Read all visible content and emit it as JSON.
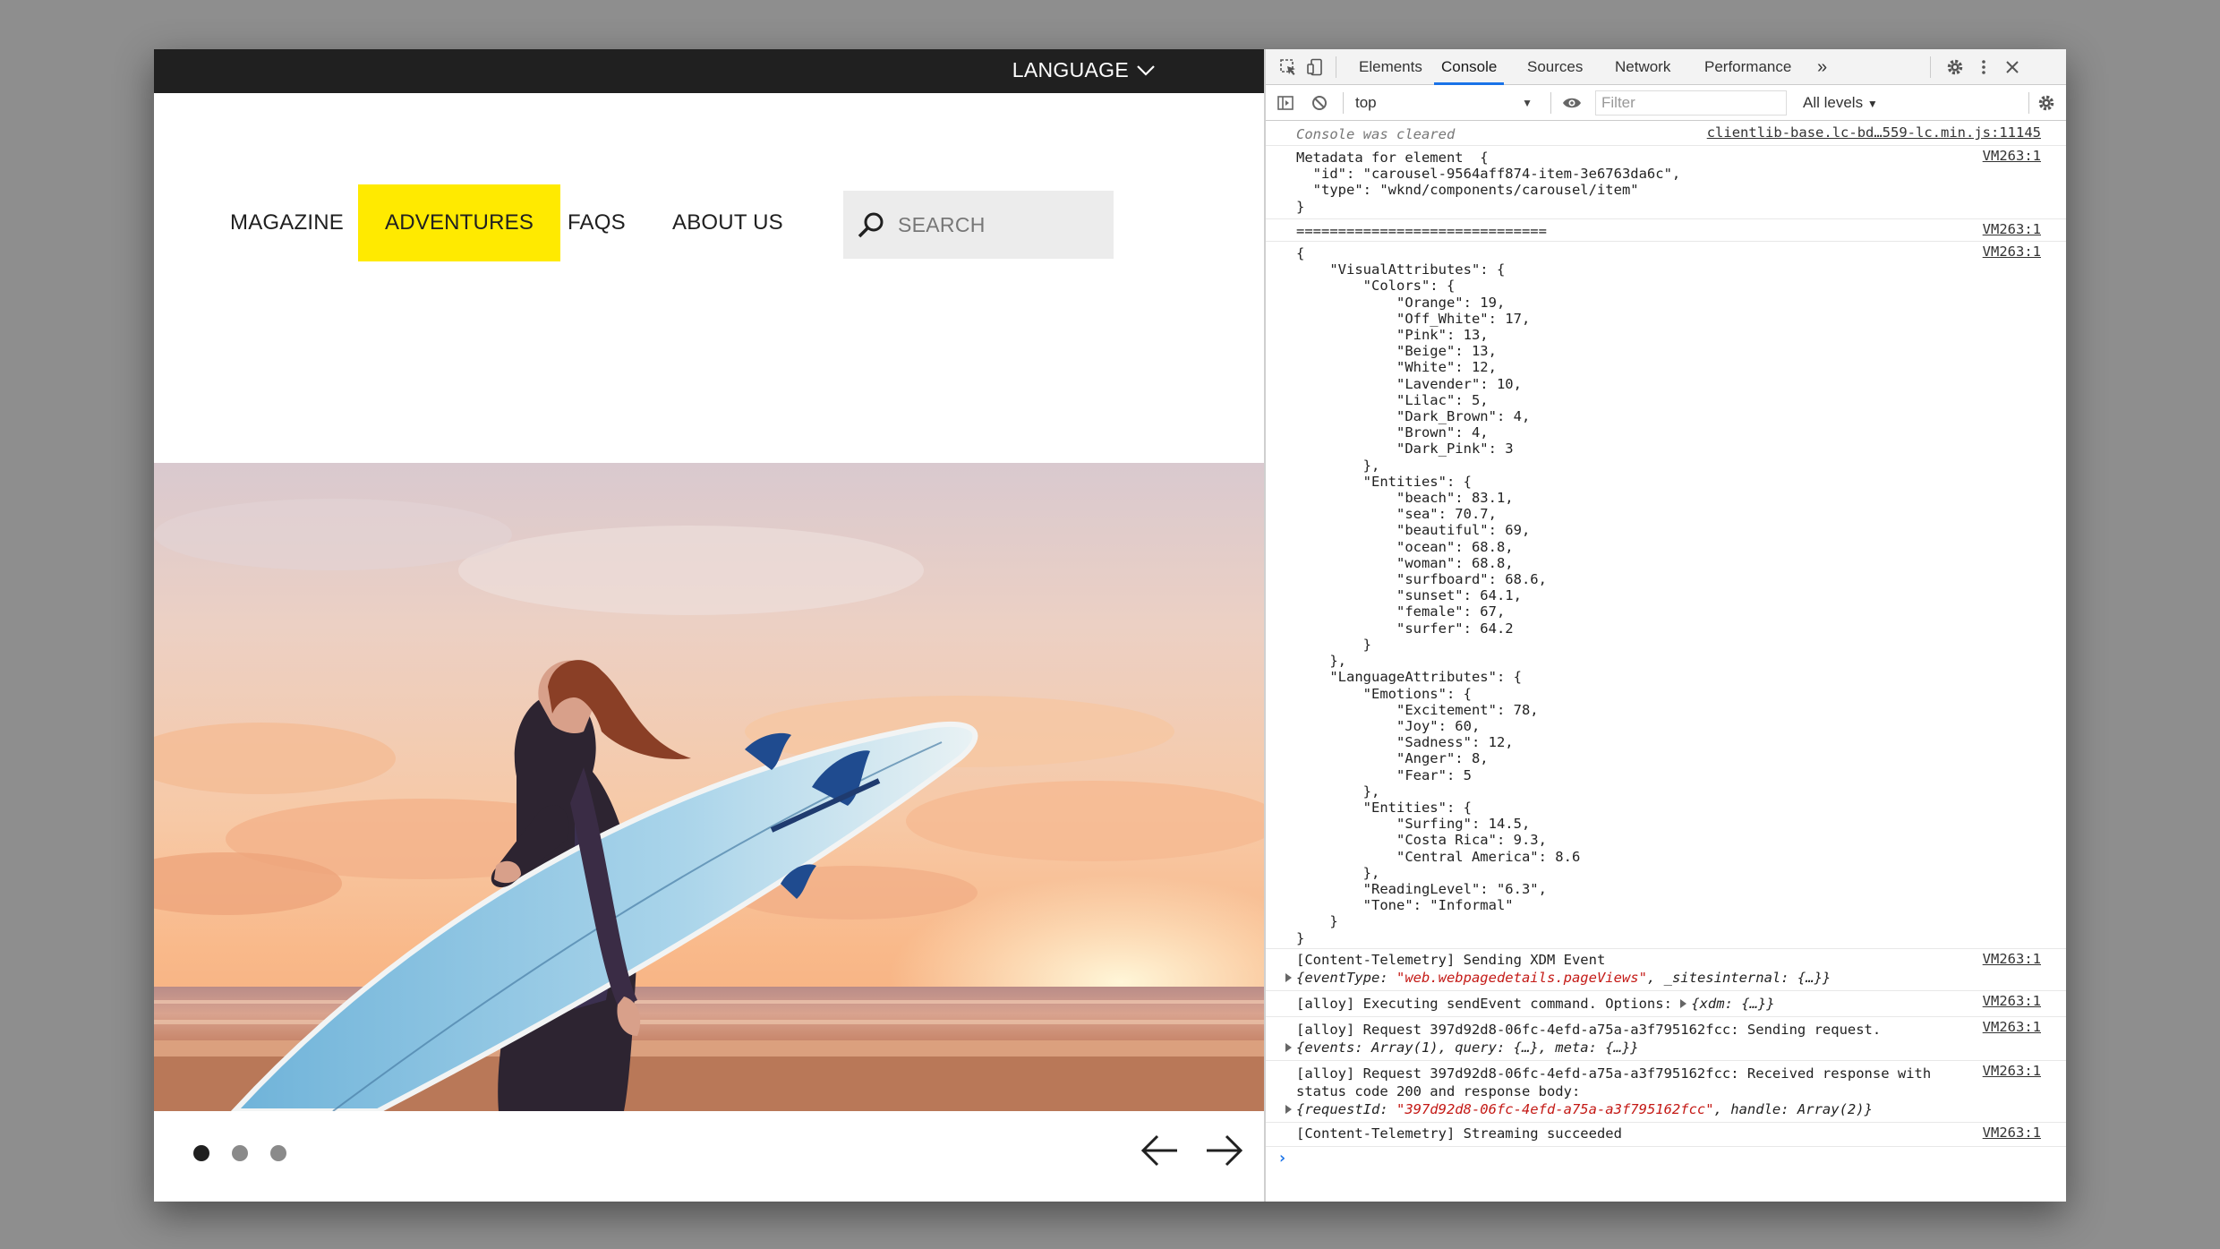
{
  "site": {
    "language_label": "LANGUAGE",
    "nav": [
      {
        "label": "MAGAZINE"
      },
      {
        "label": "ADVENTURES",
        "active": true
      },
      {
        "label": "FAQS"
      },
      {
        "label": "ABOUT US"
      }
    ],
    "search": {
      "placeholder": "SEARCH"
    },
    "carousel": {
      "slide_count": 3,
      "active_index": 0
    },
    "accent_color": "#ffea00"
  },
  "devtools": {
    "tabs": [
      {
        "label": "Elements"
      },
      {
        "label": "Console",
        "active": true
      },
      {
        "label": "Sources"
      },
      {
        "label": "Network"
      },
      {
        "label": "Performance"
      }
    ],
    "more_tabs_label": "»",
    "context": "top",
    "filter_placeholder": "Filter",
    "levels": "All levels",
    "messages": {
      "cleared": {
        "text": "Console was cleared",
        "source": "clientlib-base.lc-bd…559-lc.min.js:11145"
      },
      "metadata": {
        "text": "Metadata for element  {\n  \"id\": \"carousel-9564aff874-item-3e6763da6c\",\n  \"type\": \"wknd/components/carousel/item\"\n}",
        "source": "VM263:1"
      },
      "separator": {
        "text": "==============================",
        "source": "VM263:1"
      },
      "json": {
        "text": "{\n    \"VisualAttributes\": {\n        \"Colors\": {\n            \"Orange\": 19,\n            \"Off_White\": 17,\n            \"Pink\": 13,\n            \"Beige\": 13,\n            \"White\": 12,\n            \"Lavender\": 10,\n            \"Lilac\": 5,\n            \"Dark_Brown\": 4,\n            \"Brown\": 4,\n            \"Dark_Pink\": 3\n        },\n        \"Entities\": {\n            \"beach\": 83.1,\n            \"sea\": 70.7,\n            \"beautiful\": 69,\n            \"ocean\": 68.8,\n            \"woman\": 68.8,\n            \"surfboard\": 68.6,\n            \"sunset\": 64.1,\n            \"female\": 67,\n            \"surfer\": 64.2\n        }\n    },\n    \"LanguageAttributes\": {\n        \"Emotions\": {\n            \"Excitement\": 78,\n            \"Joy\": 60,\n            \"Sadness\": 12,\n            \"Anger\": 8,\n            \"Fear\": 5\n        },\n        \"Entities\": {\n            \"Surfing\": 14.5,\n            \"Costa Rica\": 9.3,\n            \"Central America\": 8.6\n        },\n        \"ReadingLevel\": \"6.3\",\n        \"Tone\": \"Informal\"\n    }\n}",
        "source": "VM263:1"
      },
      "telemetry_send": {
        "line": "[Content-Telemetry] Sending XDM Event",
        "obj_pre": "{eventType: ",
        "obj_red": "\"web.webpagedetails.pageViews\"",
        "obj_post": ", _sitesinternal: {…}}",
        "source": "VM263:1"
      },
      "alloy_exec": {
        "line": "[alloy] Executing sendEvent command. Options: ",
        "obj": "{xdm: {…}}",
        "source": "VM263:1"
      },
      "alloy_request": {
        "line": "[alloy] Request 397d92d8-06fc-4efd-a75a-a3f795162fcc: Sending request.",
        "obj": "{events: Array(1), query: {…}, meta: {…}}",
        "source": "VM263:1"
      },
      "alloy_response": {
        "line1": "[alloy] Request 397d92d8-06fc-4efd-a75a-a3f795162fcc: Received response with",
        "line2": "status code 200 and response body:",
        "obj_pre": "{requestId: ",
        "obj_red": "\"397d92d8-06fc-4efd-a75a-a3f795162fcc\"",
        "obj_post": ", handle: Array(2)}",
        "source": "VM263:1"
      },
      "streaming": {
        "line": "[Content-Telemetry] Streaming succeeded",
        "source": "VM263:1"
      }
    },
    "prompt": "›"
  }
}
